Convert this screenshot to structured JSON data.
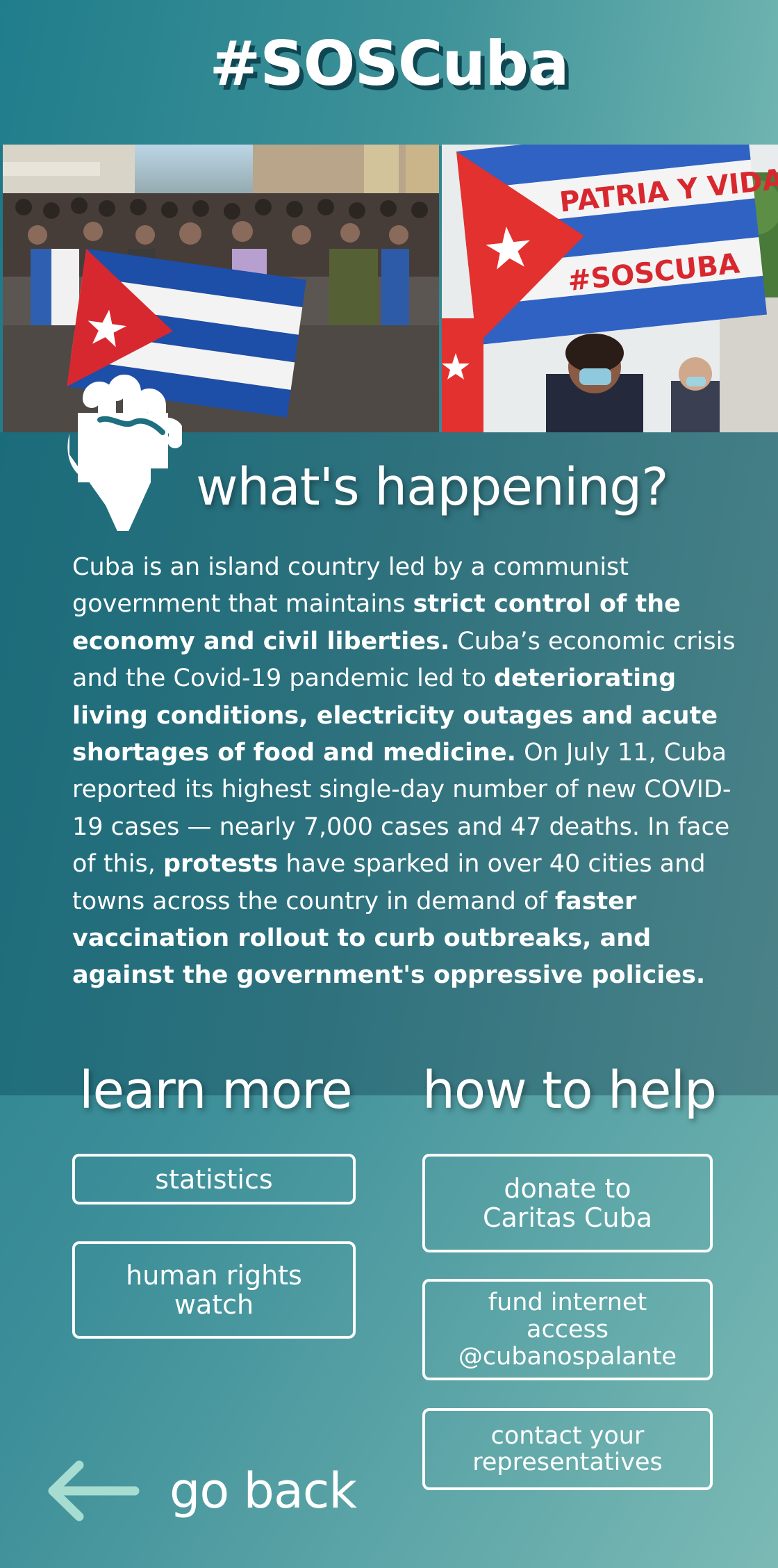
{
  "header": {
    "title": "#SOSCuba"
  },
  "photos": {
    "left_alt": "Protesters marching with a Cuban flag",
    "right_sign_line1": "PATRIA Y VIDA",
    "right_sign_line2": "#SOSCUBA"
  },
  "whats_happening": {
    "heading": "what's happening?",
    "paragraph": [
      {
        "text": "Cuba is an island country led by a communist government that maintains ",
        "bold": false
      },
      {
        "text": "strict control of the economy and civil liberties.",
        "bold": true
      },
      {
        "text": " Cuba’s economic crisis and the Covid-19 pandemic led to ",
        "bold": false
      },
      {
        "text": "deteriorating living conditions, electricity outages and acute shortages of food and medicine.",
        "bold": true
      },
      {
        "text": " On July 11, Cuba reported its highest single-day number of new COVID-19 cases — nearly 7,000 cases and 47 deaths. In face of this, ",
        "bold": false
      },
      {
        "text": "protests",
        "bold": true
      },
      {
        "text": " have sparked in over 40 cities and towns across the country in demand of ",
        "bold": false
      },
      {
        "text": "faster vaccination rollout to curb outbreaks, and against the government's oppressive policies.",
        "bold": true
      }
    ]
  },
  "learn_more": {
    "heading": "learn more",
    "buttons": [
      {
        "label": "statistics"
      },
      {
        "label_line1": "human rights",
        "label_line2": "watch"
      }
    ]
  },
  "how_to_help": {
    "heading": "how to help",
    "buttons": [
      {
        "label_line1": "donate to",
        "label_line2": "Caritas Cuba"
      },
      {
        "label_line1": "fund internet",
        "label_line2": "access",
        "label_line3": "@cubanospalante"
      },
      {
        "label_line1": "contact your",
        "label_line2": "representatives"
      }
    ]
  },
  "navigation": {
    "back_label": "go back",
    "arrow_color": "#a7dcd0"
  },
  "colors": {
    "teal_dark": "#1b6c7b",
    "teal_light": "#7bbab5",
    "title_shadow": "#0f4652",
    "flag_blue": "#1d4ea8",
    "flag_red": "#d8282f"
  }
}
